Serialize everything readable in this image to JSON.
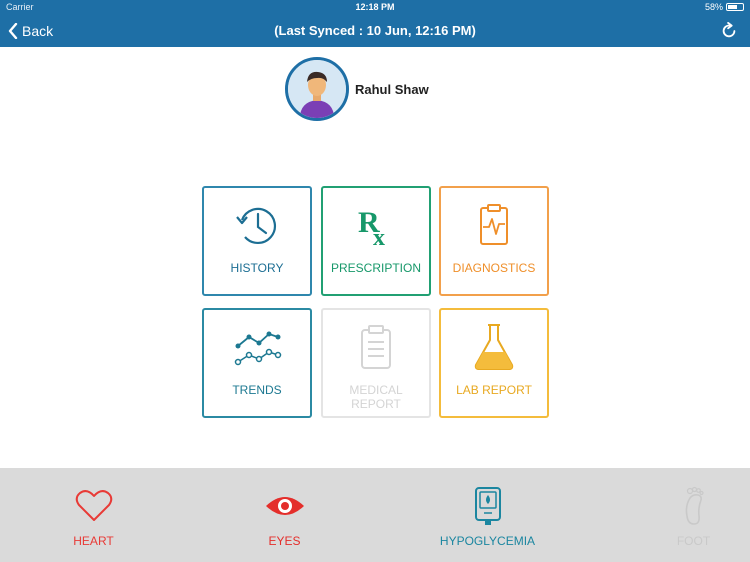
{
  "status_bar": {
    "carrier": "Carrier",
    "time": "12:18 PM",
    "battery": "58%"
  },
  "navbar": {
    "back_label": "Back",
    "title": "(Last Synced : 10 Jun, 12:16 PM)"
  },
  "profile": {
    "name": "Rahul Shaw"
  },
  "tiles": [
    {
      "label": "HISTORY",
      "icon": "history-clock-icon"
    },
    {
      "label": "PRESCRIPTION",
      "icon": "rx-icon"
    },
    {
      "label": "DIAGNOSTICS",
      "icon": "clipboard-pulse-icon"
    },
    {
      "label": "TRENDS",
      "icon": "trend-line-icon"
    },
    {
      "label": "MEDICAL REPORT",
      "icon": "clipboard-list-icon"
    },
    {
      "label": "LAB REPORT",
      "icon": "flask-icon"
    }
  ],
  "bottom_tabs": [
    {
      "label": "HEART",
      "icon": "heart-icon",
      "color": "#e83a36"
    },
    {
      "label": "EYES",
      "icon": "eye-icon",
      "color": "#e42e2b"
    },
    {
      "label": "HYPOGLYCEMIA",
      "icon": "glucose-meter-icon",
      "color": "#1b86a0"
    },
    {
      "label": "FOOT",
      "icon": "foot-icon",
      "color": "#c9c9c9"
    }
  ],
  "colors": {
    "header": "#1e6fa6",
    "bottom_bar": "#dadada"
  }
}
